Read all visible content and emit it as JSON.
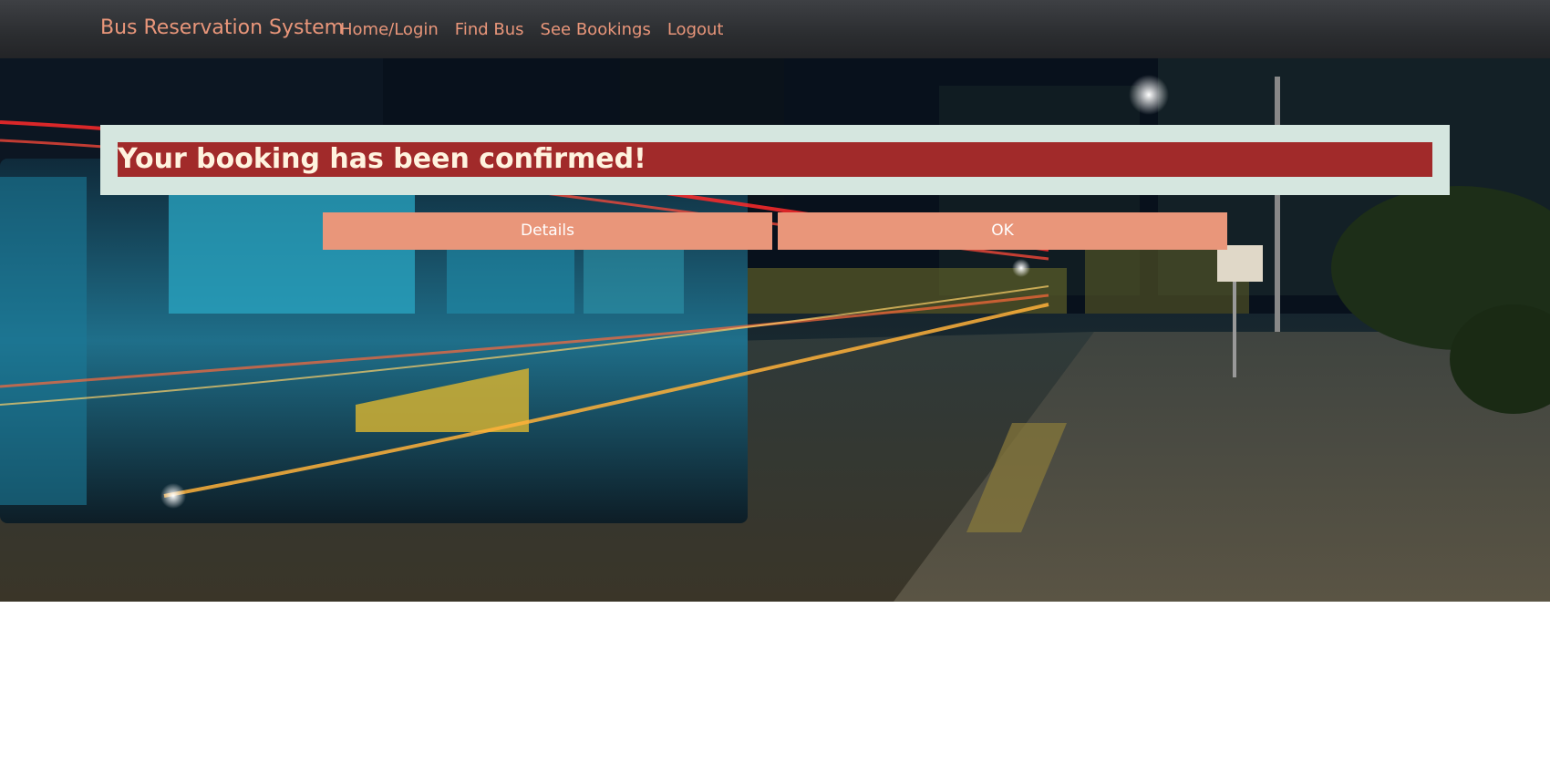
{
  "navbar": {
    "brand": "Bus Reservation System",
    "links": [
      {
        "label": "Home/Login"
      },
      {
        "label": "Find Bus"
      },
      {
        "label": "See Bookings"
      },
      {
        "label": "Logout"
      }
    ]
  },
  "alert": {
    "message": "Your booking has been confirmed!"
  },
  "actions": {
    "details_label": "Details",
    "ok_label": "OK"
  },
  "colors": {
    "accent": "#e9967a",
    "alert_bg": "#a12a2a",
    "alert_panel": "#d5e6df",
    "navbar": "#2b2d30"
  },
  "hero": {
    "image": "city-street-bus-night-photo"
  }
}
